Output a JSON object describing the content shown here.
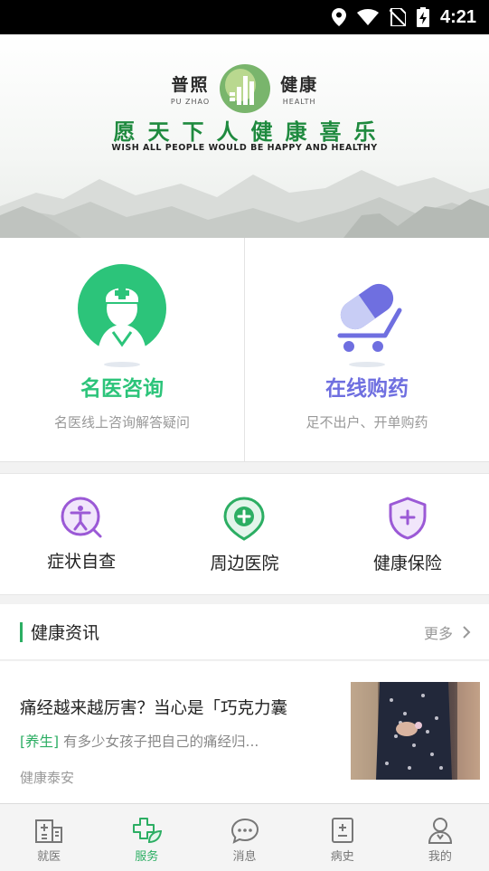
{
  "status_bar": {
    "time": "4:21"
  },
  "banner": {
    "brand_cn_left": "普照",
    "brand_en_left": "PU ZHAO",
    "brand_cn_right": "健康",
    "brand_en_right": "HEALTH",
    "slogan": "愿天下人健康喜乐",
    "slogan_en": "WISH ALL PEOPLE WOULD BE HAPPY AND HEALTHY"
  },
  "top_cards": [
    {
      "title": "名医咨询",
      "subtitle": "名医线上咨询解答疑问",
      "color": "#2cc47a",
      "icon": "doctor-icon"
    },
    {
      "title": "在线购药",
      "subtitle": "足不出户、开单购药",
      "color": "#6f6fe0",
      "icon": "pill-cart-icon"
    }
  ],
  "quick_services": [
    {
      "label": "症状自查",
      "icon": "person-search-icon",
      "color": "#9b59d6"
    },
    {
      "label": "周边医院",
      "icon": "location-plus-icon",
      "color": "#2cae63"
    },
    {
      "label": "健康保险",
      "icon": "shield-plus-icon",
      "color": "#9b59d6"
    }
  ],
  "news": {
    "section_title": "健康资讯",
    "more_label": "更多",
    "items": [
      {
        "headline": "痛经越来越厉害？当心是「巧克力囊",
        "tag": "[养生]",
        "summary": " 有多少女孩子把自己的痛经归...",
        "source": "健康泰安"
      }
    ]
  },
  "tabbar": {
    "active_color": "#2cae63",
    "items": [
      {
        "label": "就医",
        "icon": "hospital-icon"
      },
      {
        "label": "服务",
        "icon": "cross-leaf-icon",
        "active": true
      },
      {
        "label": "消息",
        "icon": "chat-icon"
      },
      {
        "label": "病史",
        "icon": "record-icon"
      },
      {
        "label": "我的",
        "icon": "user-icon"
      }
    ]
  }
}
